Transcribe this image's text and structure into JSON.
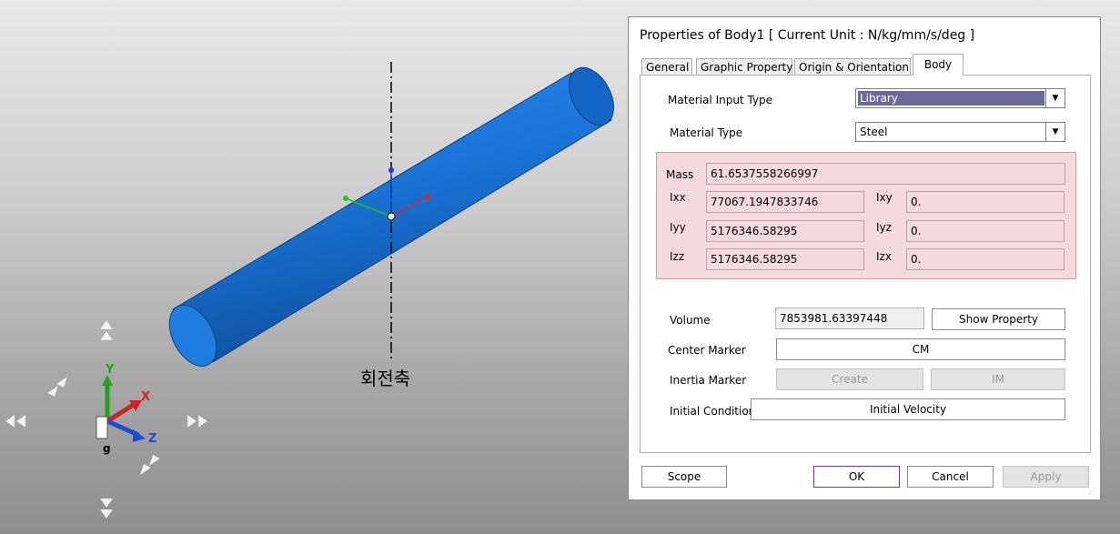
{
  "viewport": {
    "axis_caption": "회전축",
    "triad": {
      "y": "Y",
      "x": "X",
      "z": "Z",
      "g": "g"
    }
  },
  "dialog": {
    "title": "Properties of Body1 [ Current Unit : N/kg/mm/s/deg ]",
    "tabs": [
      "General",
      "Graphic Property",
      "Origin & Orientation",
      "Body"
    ],
    "active_tab": "Body",
    "material_input_type": {
      "label": "Material Input Type",
      "value": "Library"
    },
    "material_type": {
      "label": "Material Type",
      "value": "Steel"
    },
    "mass": {
      "label": "Mass",
      "value": "61.6537558266997"
    },
    "inertia": {
      "ixx": {
        "label": "Ixx",
        "value": "77067.1947833746"
      },
      "iyy": {
        "label": "Iyy",
        "value": "5176346.58295"
      },
      "izz": {
        "label": "Izz",
        "value": "5176346.58295"
      },
      "ixy": {
        "label": "Ixy",
        "value": "0."
      },
      "iyz": {
        "label": "Iyz",
        "value": "0."
      },
      "izx": {
        "label": "Izx",
        "value": "0."
      }
    },
    "volume": {
      "label": "Volume",
      "value": "7853981.63397448",
      "button": "Show Property"
    },
    "center_marker": {
      "label": "Center Marker",
      "button": "CM"
    },
    "inertia_marker": {
      "label": "Inertia Marker",
      "create": "Create",
      "im": "IM"
    },
    "initial_condition": {
      "label": "Initial Condition",
      "button": "Initial Velocity"
    },
    "footer": {
      "scope": "Scope",
      "ok": "OK",
      "cancel": "Cancel",
      "apply": "Apply"
    }
  },
  "colors": {
    "cylinder": "#1a73d6",
    "selection": "#6c6a9a",
    "pink": "#f5dadd"
  }
}
